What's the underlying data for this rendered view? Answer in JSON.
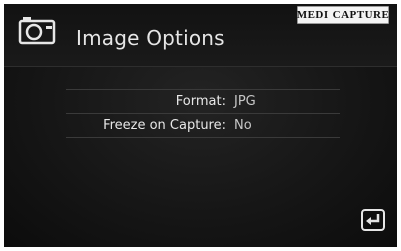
{
  "header": {
    "title": "Image Options",
    "icon": "camera-icon"
  },
  "brand": {
    "part1": "Medi",
    "part2": "Capture"
  },
  "options": [
    {
      "label": "Format:",
      "value": "JPG"
    },
    {
      "label": "Freeze on Capture:",
      "value": "No"
    }
  ],
  "footer": {
    "back_icon": "enter-return-icon"
  },
  "colors": {
    "background": "#161616",
    "text": "#e6e6e6",
    "divider": "#3a3a3a"
  }
}
